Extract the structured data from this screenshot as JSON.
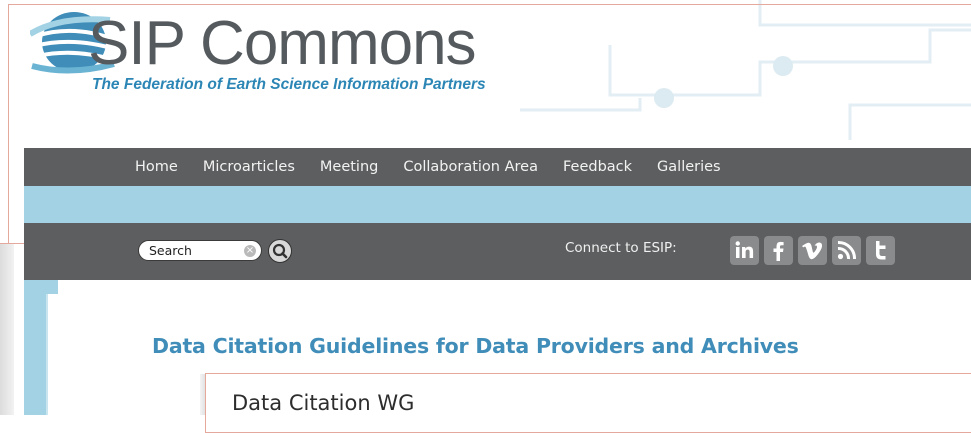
{
  "logo": {
    "wordmark": "SIP Commons",
    "tagline": "The Federation of Earth Science Information Partners"
  },
  "nav": {
    "items": [
      {
        "label": "Home"
      },
      {
        "label": "Microarticles"
      },
      {
        "label": "Meeting"
      },
      {
        "label": "Collaboration Area"
      },
      {
        "label": "Feedback"
      },
      {
        "label": "Galleries"
      }
    ]
  },
  "utility": {
    "search_value": "Search",
    "connect_label": "Connect to ESIP:",
    "social": [
      "linkedin-icon",
      "facebook-icon",
      "vimeo-icon",
      "rss-icon",
      "twitter-icon"
    ]
  },
  "content": {
    "page_title": "Data Citation Guidelines for Data Providers and Archives",
    "section_heading": "Data Citation WG"
  },
  "colors": {
    "nav_bg": "#5d5e5f",
    "band_blue": "#a2d2e4",
    "title_blue": "#3f8db8",
    "logo_blue": "#2c86b5",
    "frame_pink": "#e4a89c"
  }
}
